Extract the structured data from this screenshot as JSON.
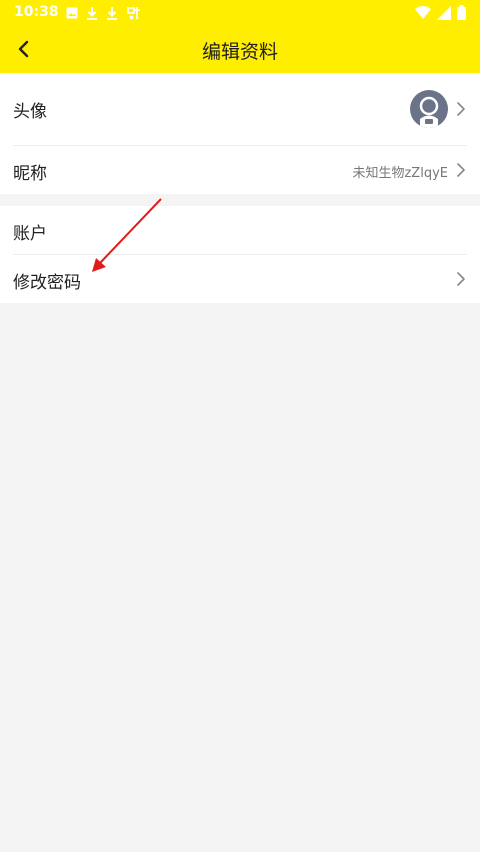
{
  "status_bar": {
    "time": "10:38",
    "left_icons": [
      "gallery-icon",
      "download-icon",
      "download-icon",
      "app-notification-icon"
    ],
    "right_icons": [
      "wifi-icon",
      "signal-icon",
      "battery-icon"
    ]
  },
  "header": {
    "title": "编辑资料",
    "back_icon": "chevron-left-icon",
    "background": "#ffee00"
  },
  "profile": {
    "avatar_label": "头像",
    "nickname_label": "昵称",
    "nickname_value": "未知生物zZlqyE"
  },
  "account": {
    "section_label": "账户",
    "change_password_label": "修改密码"
  },
  "annotation": {
    "arrow_color": "#e01c1c"
  }
}
